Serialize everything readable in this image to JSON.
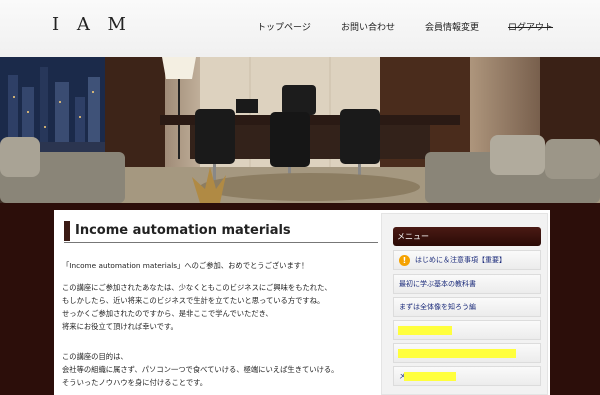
{
  "site": {
    "logo": "I A M"
  },
  "nav": {
    "items": [
      {
        "label": "トップページ"
      },
      {
        "label": "お問い合わせ"
      },
      {
        "label": "会員情報変更"
      },
      {
        "label": "ログアウト"
      }
    ]
  },
  "main": {
    "title": "Income automation materials",
    "paragraph1": "「Income automation materials」へのご参加、おめでとうございます！",
    "paragraph2": [
      "この講座にご参加されたあなたは、少なくともこのビジネスにご興味をもたれた、",
      "もしかしたら、近い将来このビジネスで生計を立てたいと思っている方ですね。",
      "せっかくご参加されたのですから、是非ここで学んでいただき、",
      "将来にお役立て頂ければ幸いです。"
    ],
    "paragraph3": [
      "この講座の目的は、",
      "会社等の組織に属さず、パソコン一つで食べていける、極端にいえば生きていける。",
      "そういったノウハウを身に付けることです。"
    ]
  },
  "sidebar": {
    "header": "メニュー",
    "items": [
      {
        "label": "はじめに＆注意事項【重要】"
      },
      {
        "label": "最初に学ぶ基本の教科書"
      },
      {
        "label": "まずは全体像を知ろう編"
      },
      {
        "label": ""
      },
      {
        "label": ""
      },
      {
        "label": "メ"
      }
    ]
  },
  "colors": {
    "accent": "#2c0e0a",
    "link": "#1a2a7a",
    "highlight": "#ffff33",
    "warning": "#f5a200"
  }
}
